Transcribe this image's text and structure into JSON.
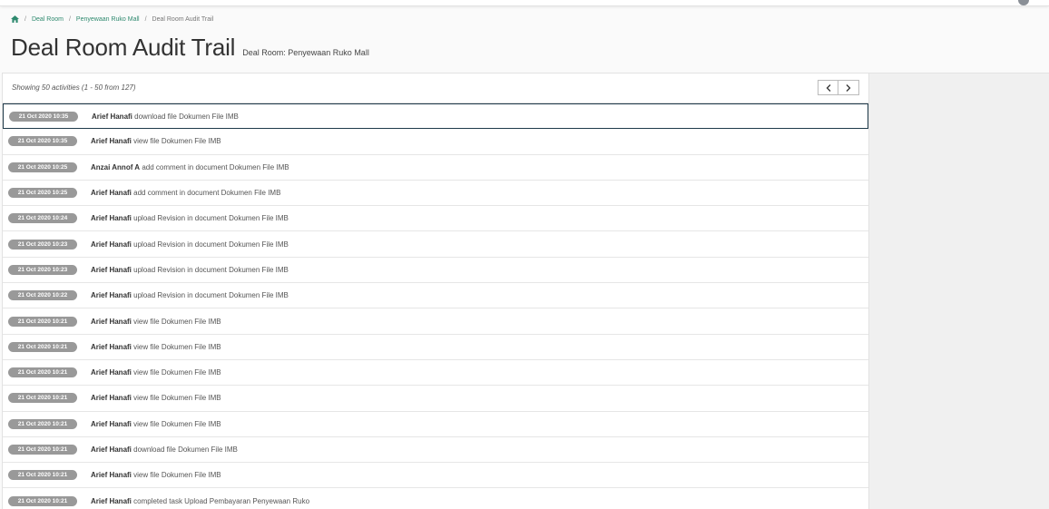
{
  "breadcrumb": {
    "home_icon": "home-icon",
    "items": [
      "Deal Room",
      "Penyewaan Ruko Mall"
    ],
    "current": "Deal Room Audit Trail"
  },
  "page": {
    "title": "Deal Room Audit Trail",
    "subtitle": "Deal Room: Penyewaan Ruko Mall"
  },
  "list": {
    "summary": "Showing 50 activities (1 - 50 from 127)",
    "prev_icon": "chevron-left-icon",
    "next_icon": "chevron-right-icon",
    "activities": [
      {
        "time": "21 Oct 2020 10:35",
        "user": "Arief Hanafi",
        "action": "download file Dokumen File IMB",
        "selected": true
      },
      {
        "time": "21 Oct 2020 10:35",
        "user": "Arief Hanafi",
        "action": "view file Dokumen File IMB"
      },
      {
        "time": "21 Oct 2020 10:25",
        "user": "Anzai Annof A",
        "action": "add comment in document Dokumen File IMB"
      },
      {
        "time": "21 Oct 2020 10:25",
        "user": "Arief Hanafi",
        "action": "add comment in document Dokumen File IMB"
      },
      {
        "time": "21 Oct 2020 10:24",
        "user": "Arief Hanafi",
        "action": "upload Revision in document Dokumen File IMB"
      },
      {
        "time": "21 Oct 2020 10:23",
        "user": "Arief Hanafi",
        "action": "upload Revision in document Dokumen File IMB"
      },
      {
        "time": "21 Oct 2020 10:23",
        "user": "Arief Hanafi",
        "action": "upload Revision in document Dokumen File IMB"
      },
      {
        "time": "21 Oct 2020 10:22",
        "user": "Arief Hanafi",
        "action": "upload Revision in document Dokumen File IMB"
      },
      {
        "time": "21 Oct 2020 10:21",
        "user": "Arief Hanafi",
        "action": "view file Dokumen File IMB"
      },
      {
        "time": "21 Oct 2020 10:21",
        "user": "Arief Hanafi",
        "action": "view file Dokumen File IMB"
      },
      {
        "time": "21 Oct 2020 10:21",
        "user": "Arief Hanafi",
        "action": "view file Dokumen File IMB"
      },
      {
        "time": "21 Oct 2020 10:21",
        "user": "Arief Hanafi",
        "action": "view file Dokumen File IMB"
      },
      {
        "time": "21 Oct 2020 10:21",
        "user": "Arief Hanafi",
        "action": "view file Dokumen File IMB"
      },
      {
        "time": "21 Oct 2020 10:21",
        "user": "Arief Hanafi",
        "action": "download file Dokumen File IMB"
      },
      {
        "time": "21 Oct 2020 10:21",
        "user": "Arief Hanafi",
        "action": "view file Dokumen File IMB"
      },
      {
        "time": "21 Oct 2020 10:21",
        "user": "Arief Hanafi",
        "action": "completed task Upload Pembayaran Penyewaan Ruko"
      }
    ]
  },
  "colors": {
    "accent": "#2f8a6f",
    "badge": "#999999",
    "selected_border": "#1f3a4a"
  }
}
